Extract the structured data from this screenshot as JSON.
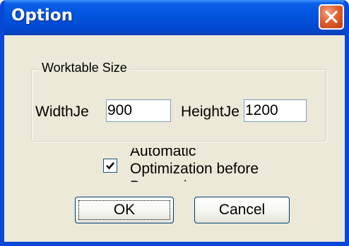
{
  "window": {
    "title": "Option",
    "close_icon": "close-icon"
  },
  "worktable": {
    "legend": "Worktable Size",
    "width_label": "WidthJe",
    "width_value": "900",
    "height_label": "HeightJe",
    "height_value": "1200"
  },
  "optimization": {
    "checked": true,
    "label": "Automatic Optimization before Processing"
  },
  "buttons": {
    "ok_label": "OK",
    "cancel_label": "Cancel"
  },
  "colors": {
    "titlebar": "#0254dc",
    "window_face": "#ece9d8",
    "close_button": "#e0602f",
    "border": "#0a47d6"
  }
}
